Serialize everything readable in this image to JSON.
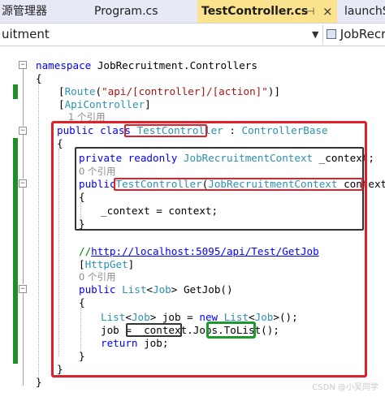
{
  "tabs": [
    {
      "label": "源管理器",
      "active": false
    },
    {
      "label": "Program.cs",
      "active": false
    },
    {
      "label": "TestController.cs",
      "active": true,
      "pin": "⊣",
      "close": "×"
    },
    {
      "label": "launchS",
      "active": false
    }
  ],
  "nav": {
    "project": "uitment",
    "member": "JobRecrui"
  },
  "refs": {
    "r1": "1 个引用",
    "r2": "0 个引用",
    "r3": "0 个引用"
  },
  "code": {
    "ns_kw": "namespace",
    "ns_name": " JobRecruitment.Controllers",
    "brace_open": "{",
    "brace_close": "}",
    "route_open": "[",
    "route_attr": "Route",
    "route_paren": "(",
    "route_str": "\"api/[controller]/[action]\"",
    "route_close": ")]",
    "api_open": "[",
    "api_attr": "ApiController",
    "api_close": "]",
    "cls_public": "public",
    "cls_class": " class ",
    "cls_name": "TestController",
    "cls_colon": " : ",
    "cls_base": "ControllerBase",
    "fld_private": "private",
    "fld_readonly": " readonly ",
    "fld_type": "JobRecruitmentContext",
    "fld_name": " _context;",
    "ctor_public": "public",
    "ctor_name": "TestController",
    "ctor_open": "(",
    "ctor_ptype": "JobRecruitmentContext",
    "ctor_pname": " context)",
    "assign": "_context = context;",
    "cm_slashes": "//",
    "cm_url": "http://localhost:5095/api/Test/GetJob",
    "hg_open": "[",
    "hg_attr": "HttpGet",
    "hg_close": "]",
    "m_public": "public",
    "m_list": " List",
    "m_lt": "<",
    "m_job": "Job",
    "m_gt": ">",
    "m_name": " GetJob()",
    "l1_list": "List",
    "l1_lt": "<",
    "l1_job": "Job",
    "l1_mid": "> job = ",
    "l1_new": "new",
    "l1_sp": " ",
    "l1_list2": "List",
    "l1_lt2": "<",
    "l1_job2": "Job",
    "l1_end": ">();",
    "l2_start": "job = ",
    "l2_ctx": "_context.",
    "l2_jobs": "Jobs.",
    "l2_tolist": "ToList()",
    "l2_end": ";",
    "ret_kw": "return",
    "ret_rest": " job;"
  },
  "watermark": "CSDN @小吴同学",
  "colors": {
    "keyword": "#0000ff",
    "type": "#2b91af",
    "string": "#a31515",
    "comment": "#008000",
    "active_tab": "#fbe28c",
    "highlight_red": "#e0202a",
    "highlight_green": "#1a9a2a",
    "change_bar": "#1e8f2b"
  }
}
